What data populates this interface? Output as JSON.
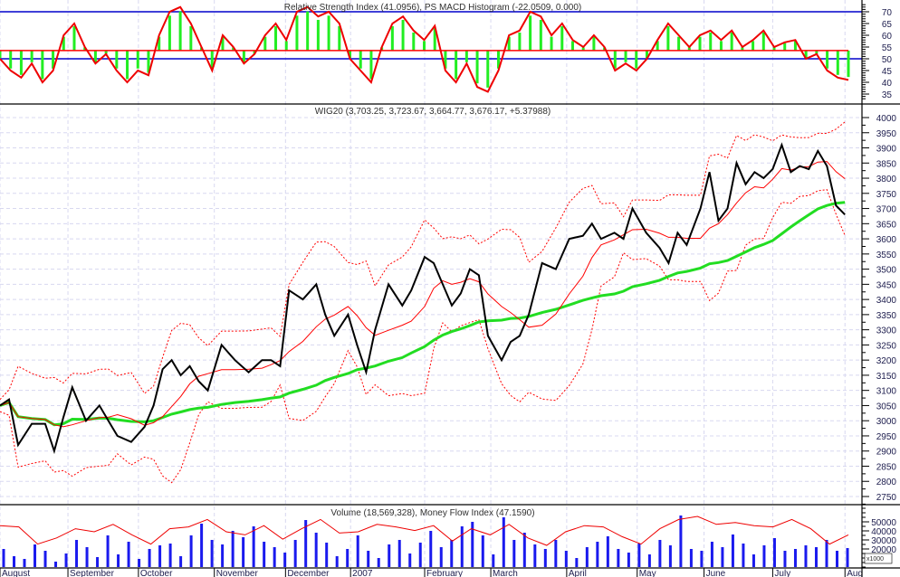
{
  "chart_data": [
    {
      "type": "line",
      "panel": "rsi",
      "title": "Relative Strength Index (41.0956), PS MACD Histogram (-22.0509, 0.000)",
      "yticks": [
        35,
        40,
        45,
        50,
        55,
        60,
        65,
        70
      ],
      "ylim": [
        32,
        74
      ],
      "reference_lines": [
        70,
        50
      ],
      "histogram_base": 53.5,
      "rsi": [
        50,
        45,
        42,
        48,
        40,
        45,
        60,
        65,
        55,
        48,
        52,
        45,
        40,
        45,
        43,
        60,
        70,
        72,
        65,
        55,
        45,
        60,
        55,
        48,
        52,
        60,
        65,
        58,
        70,
        72,
        68,
        70,
        65,
        50,
        45,
        40,
        55,
        65,
        68,
        62,
        58,
        64,
        45,
        40,
        48,
        38,
        36,
        45,
        60,
        62,
        70,
        68,
        60,
        65,
        58,
        55,
        60,
        55,
        45,
        48,
        45,
        50,
        58,
        65,
        60,
        55,
        60,
        62,
        58,
        62,
        55,
        58,
        62,
        55,
        57,
        58,
        50,
        52,
        45,
        42,
        41
      ]
    },
    {
      "type": "line",
      "panel": "price",
      "title": "WIG20 (3,703.25, 3,723.67, 3,664.77, 3,676.17, +5.37988)",
      "ylim": [
        2725,
        4025
      ],
      "yticks": [
        2750,
        2800,
        2850,
        2900,
        2950,
        3000,
        3050,
        3100,
        3150,
        3200,
        3250,
        3300,
        3350,
        3400,
        3450,
        3500,
        3550,
        3600,
        3650,
        3700,
        3750,
        3800,
        3850,
        3900,
        3950,
        4000
      ],
      "x_day": [
        0,
        2.5,
        5,
        8.8,
        12.5,
        15,
        17.5,
        20,
        23.8,
        27.5,
        30,
        32.5,
        36.3,
        40,
        42.5,
        45,
        47.5,
        50,
        52.5,
        55,
        57.5,
        61.3,
        65,
        68.8,
        72.5,
        75,
        77.5,
        80,
        83.8,
        87.5,
        90,
        92.5,
        96.3,
        98.8,
        101.3,
        103.8,
        107.5,
        111.3,
        113.8,
        117.5,
        120,
        122.5,
        125,
        127.5,
        130,
        132.5,
        135,
        138.8,
        141.3,
        143.8,
        146.3,
        150,
        153.8,
        157.5,
        161.3,
        163.8,
        166.3,
        170,
        172.5,
        175,
        178.8,
        182.5,
        185,
        187.5,
        190,
        193.8,
        196.3,
        198.8,
        201.3,
        203.8,
        206.3,
        208.8,
        211.3,
        213.8,
        216.3,
        218.8,
        221.3,
        223.8,
        226.3,
        228.8,
        231.3,
        233.8
      ],
      "close": [
        3050,
        3070,
        2920,
        2990,
        2990,
        2900,
        3010,
        3110,
        3000,
        3050,
        3000,
        2950,
        2930,
        2980,
        3050,
        3170,
        3200,
        3150,
        3180,
        3130,
        3100,
        3250,
        3200,
        3160,
        3200,
        3200,
        3180,
        3430,
        3400,
        3450,
        3350,
        3280,
        3350,
        3250,
        3160,
        3300,
        3450,
        3380,
        3430,
        3540,
        3520,
        3450,
        3380,
        3420,
        3500,
        3480,
        3280,
        3200,
        3260,
        3280,
        3350,
        3520,
        3500,
        3600,
        3610,
        3650,
        3600,
        3620,
        3600,
        3700,
        3620,
        3570,
        3520,
        3620,
        3580,
        3700,
        3820,
        3660,
        3700,
        3850,
        3780,
        3820,
        3800,
        3830,
        3910,
        3820,
        3840,
        3830,
        3890,
        3840,
        3710,
        3680
      ],
      "series": [
        {
          "name": "WIG20",
          "color": "#000000"
        },
        {
          "name": "Short moving average",
          "color": "#ff0000"
        },
        {
          "name": "Bollinger bands",
          "color": "#ff0000"
        },
        {
          "name": "Long moving average",
          "color": "#22dd22"
        }
      ]
    },
    {
      "type": "bar",
      "panel": "volume",
      "title": "Volume (18,569,328), Money Flow Index (47.1590)",
      "yticks": [
        20000,
        30000,
        40000,
        50000
      ],
      "unit_label": "x1000",
      "volume": [
        20000,
        12000,
        9000,
        25000,
        18000,
        6000,
        15000,
        30000,
        22000,
        11000,
        35000,
        14000,
        28000,
        9000,
        20000,
        24000,
        26000,
        12000,
        35000,
        48000,
        30000,
        25000,
        40000,
        33000,
        45000,
        28000,
        22000,
        16000,
        30000,
        52000,
        38000,
        27000,
        12000,
        20000,
        35000,
        18000,
        10000,
        25000,
        30000,
        15000,
        27000,
        40000,
        22000,
        30000,
        45000,
        50000,
        35000,
        14000,
        55000,
        30000,
        38000,
        25000,
        20000,
        30000,
        18000,
        10000,
        22000,
        28000,
        34000,
        20000,
        16000,
        26000,
        14000,
        30000,
        24000,
        57000,
        20000,
        18000,
        28000,
        22000,
        36000,
        26000,
        14000,
        24000,
        32000,
        18000,
        20000,
        24000,
        22000,
        30000,
        18000,
        21000
      ],
      "mfi": [
        60,
        58,
        30,
        40,
        55,
        50,
        62,
        45,
        30,
        55,
        58,
        70,
        50,
        45,
        60,
        38,
        55,
        70,
        48,
        50,
        62,
        58,
        52,
        60,
        35,
        55,
        45,
        62,
        40,
        28,
        50,
        60,
        58,
        42,
        30,
        55,
        70,
        75,
        62,
        65,
        60,
        58,
        70,
        55,
        30,
        45
      ]
    }
  ],
  "x_axis": {
    "months": [
      {
        "label": "August",
        "day": 0
      },
      {
        "label": "September",
        "day": 18.8
      },
      {
        "label": "October",
        "day": 38.3
      },
      {
        "label": "November",
        "day": 59.3
      },
      {
        "label": "December",
        "day": 79
      },
      {
        "label": "2007",
        "day": 97
      },
      {
        "label": "February",
        "day": 117.5
      },
      {
        "label": "March",
        "day": 135.8
      },
      {
        "label": "April",
        "day": 156.8
      },
      {
        "label": "May",
        "day": 176.3
      },
      {
        "label": "June",
        "day": 194.8
      },
      {
        "label": "July",
        "day": 213.8
      },
      {
        "label": "Aug",
        "day": 233.8
      }
    ],
    "day_range": [
      0,
      238.5
    ]
  }
}
